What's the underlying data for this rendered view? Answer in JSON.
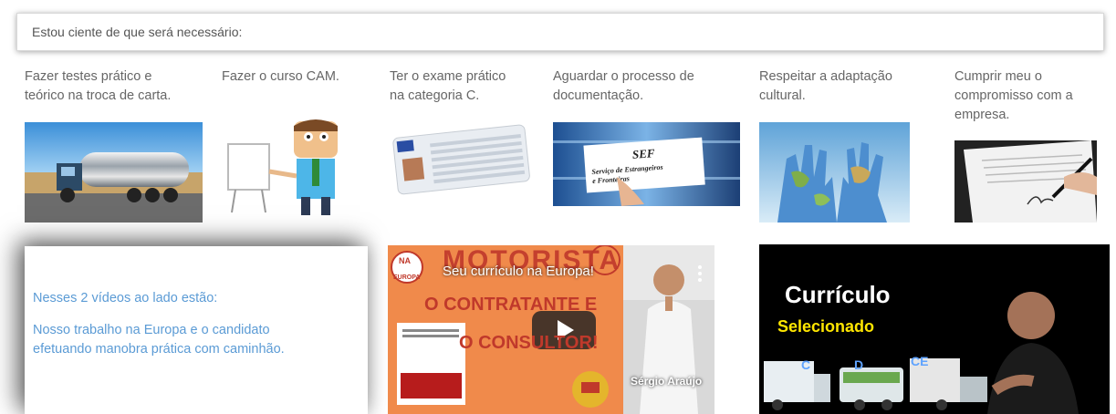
{
  "header": {
    "text": "Estou ciente de que será necessário:"
  },
  "columns": [
    {
      "text_lines": [
        "Fazer testes prático e",
        "teórico na troca de carta."
      ],
      "image": "tanker-truck"
    },
    {
      "text_lines": [
        "Fazer o curso CAM."
      ],
      "image": "teacher-whiteboard"
    },
    {
      "text_lines": [
        "Ter o exame prático",
        "na categoria C."
      ],
      "image": "driver-license"
    },
    {
      "text_lines": [
        "Aguardar o processo de",
        "documentação."
      ],
      "image": "sef-card",
      "image_text": [
        "SEF",
        "Serviço de Estrangeiros",
        "e Fronteiras"
      ]
    },
    {
      "text_lines": [
        "Respeitar a adaptação",
        "cultural."
      ],
      "image": "world-hands"
    },
    {
      "text_lines": [
        "Cumprir meu o",
        "compromisso com a",
        "empresa."
      ],
      "image": "signing-contract"
    }
  ],
  "info_card": {
    "line1": "Nesses 2 vídeos ao lado estão:",
    "line2a": "Nosso trabalho na Europa e o candidato",
    "line2b": "efetuando manobra prática com caminhão."
  },
  "video1": {
    "title": "Seu currículo na Europa!",
    "overlay_big_1": "MOTORISTA",
    "overlay_line1": "O CONTRATANTE E",
    "overlay_line2": "O CONSULTOR!",
    "logo_top": "NA",
    "logo_bottom": "EUROPA",
    "presenter": "Sérgio Araújo"
  },
  "video2": {
    "title": "Currículo",
    "subtitle": "Selecionado",
    "labels": [
      "C",
      "D",
      "CE"
    ]
  },
  "colors": {
    "link_blue": "#5b9bd5",
    "text_gray": "#666666",
    "video1_bg": "#f08a4b",
    "red_text": "#c0392b"
  }
}
